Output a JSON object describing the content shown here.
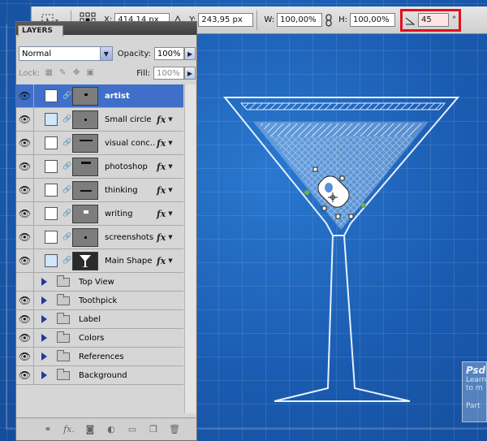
{
  "options_bar": {
    "x_label": "X:",
    "x_value": "414,14 px",
    "y_label": "Y:",
    "y_value": "243,95 px",
    "w_label": "W:",
    "w_value": "100,00%",
    "h_label": "H:",
    "h_value": "100,00%",
    "rotate_value": "45",
    "rotate_unit": "°"
  },
  "layers_panel": {
    "tab_label": "LAYERS",
    "blend_mode": "Normal",
    "opacity_label": "Opacity:",
    "opacity_value": "100%",
    "lock_label": "Lock:",
    "fill_label": "Fill:",
    "fill_value": "100%",
    "layers": [
      {
        "name": "artist",
        "selected": true,
        "fx": false
      },
      {
        "name": "Small circle",
        "fx": true
      },
      {
        "name": "visual conc...",
        "fx": true
      },
      {
        "name": "photoshop",
        "fx": true
      },
      {
        "name": "thinking",
        "fx": true
      },
      {
        "name": "writing",
        "fx": true
      },
      {
        "name": "screenshots",
        "fx": true
      },
      {
        "name": "Main Shape",
        "fx": true
      }
    ],
    "groups": [
      {
        "name": "Top View",
        "eye": false
      },
      {
        "name": "Toothpick",
        "eye": true
      },
      {
        "name": "Label",
        "eye": true
      },
      {
        "name": "Colors",
        "eye": true
      },
      {
        "name": "References",
        "eye": true
      },
      {
        "name": "Background",
        "eye": true
      }
    ]
  },
  "watermark": {
    "title": "Psd",
    "line1": "Learn",
    "line2": "to m",
    "line3": "Part"
  },
  "colors": {
    "canvas_blue": "#1f64bb",
    "selection_blue": "#3f6fc9",
    "highlight_red": "#e0101c"
  }
}
